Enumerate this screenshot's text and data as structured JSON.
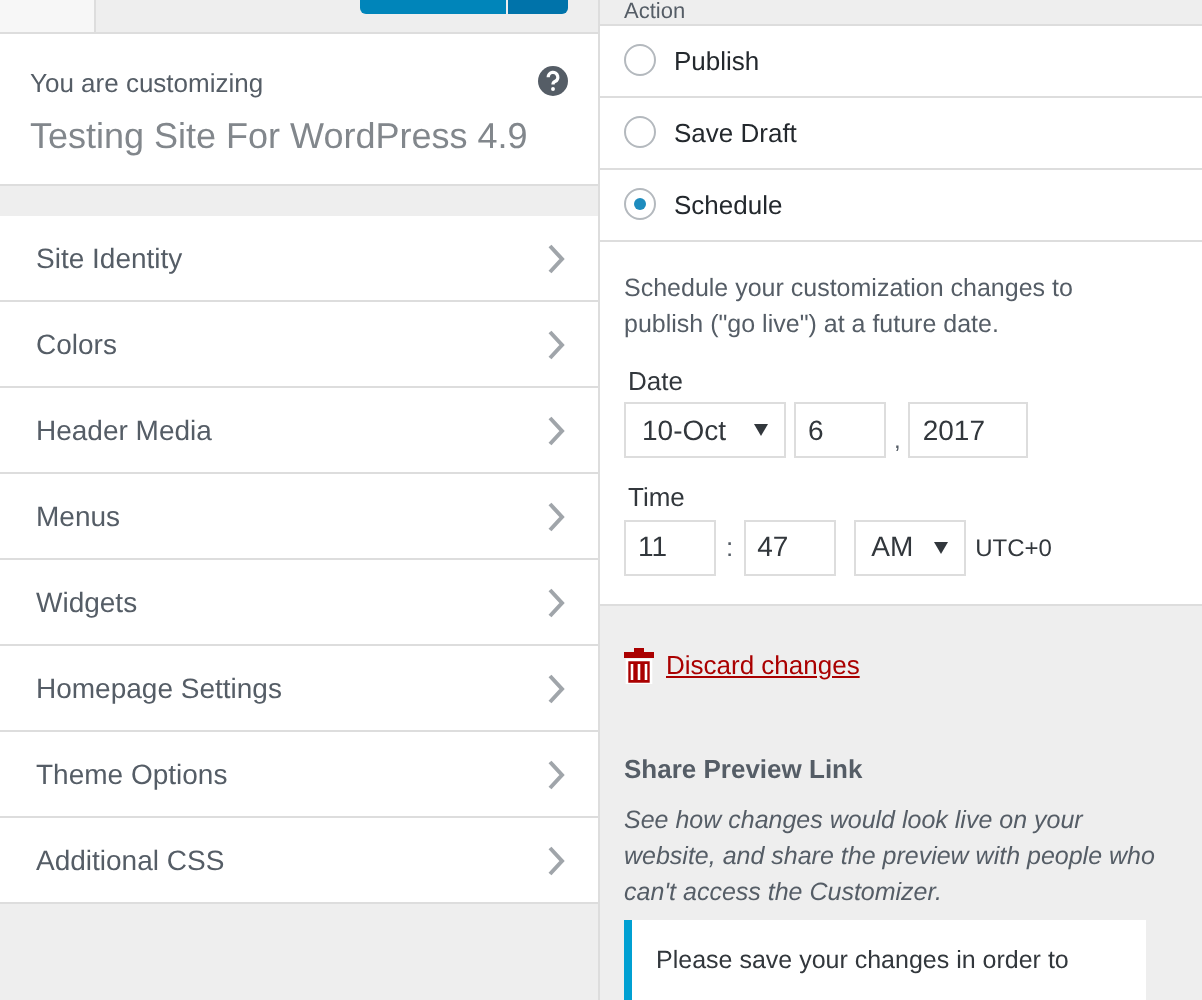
{
  "header": {
    "label": "You are customizing",
    "site_title": "Testing Site For WordPress 4.9"
  },
  "menu": [
    {
      "label": "Site Identity"
    },
    {
      "label": "Colors"
    },
    {
      "label": "Header Media"
    },
    {
      "label": "Menus"
    },
    {
      "label": "Widgets"
    },
    {
      "label": "Homepage Settings"
    },
    {
      "label": "Theme Options"
    },
    {
      "label": "Additional CSS"
    }
  ],
  "action": {
    "title": "Action",
    "options": [
      {
        "label": "Publish",
        "selected": false
      },
      {
        "label": "Save Draft",
        "selected": false
      },
      {
        "label": "Schedule",
        "selected": true
      }
    ]
  },
  "schedule": {
    "description": "Schedule your customization changes to publish (\"go live\") at a future date.",
    "date_label": "Date",
    "month": "10-Oct",
    "day": "6",
    "date_separator": ",",
    "year": "2017",
    "time_label": "Time",
    "hour": "11",
    "time_separator": ":",
    "minute": "47",
    "meridian": "AM",
    "timezone": "UTC+0"
  },
  "discard": "Discard changes",
  "share": {
    "title": "Share Preview Link",
    "description": "See how changes would look live on your website, and share the preview with people who can't access the Customizer.",
    "notice": "Please save your changes in order to"
  }
}
